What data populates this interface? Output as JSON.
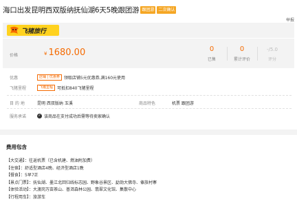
{
  "header": {
    "title": "海口出发昆明西双版纳抚仙湖6天5晚跟团游",
    "tags": [
      "跟团游",
      "二次确认"
    ],
    "report": "举报"
  },
  "brand": {
    "name": "飞猪旅行",
    "color": "#ffd21f"
  },
  "price_section": {
    "label": "价格",
    "currency": "¥",
    "price": "1680.00",
    "stats": [
      {
        "value": "0",
        "label": "已售"
      },
      {
        "value": "0",
        "label": "累计评价"
      },
      {
        "value": "-/5.0",
        "label": "评分"
      }
    ]
  },
  "promos": {
    "coupon_label": "优惠",
    "coupon_badge": "店铺 | 优惠券",
    "coupon_text": "领取店铺5元优惠券,满160元使用",
    "points_label": "飞猪里程",
    "points_badge": "飞猪里程",
    "points_text": "可抵扣840飞猪里程"
  },
  "details": {
    "destination_label": "目 的 地",
    "destination_value": "昆明  西双版纳  玉溪",
    "feature_label": "商品特色",
    "feature_value": "机票  跟团游",
    "service_label": "服务承诺",
    "service_value": "该商品在支付成功后需等待卖家确认"
  },
  "fees": {
    "title": "费用包含",
    "items": [
      "【大交通】：往返机票（已含机建、燃油附加费）",
      "【住宿】：舒适型酒店4晚、经济型酒店1晚",
      "【餐食】：5早7正",
      "【景点门票】：抚仙湖、墨江北回归线标志园、野象谷景区、勐泐大佛寺、傣族村寨",
      "【体验活动】：大渡岗万亩茶山、普洱森林公园、翡翠文化馆、集散中心",
      "【行程用车】：旅游车"
    ]
  },
  "colors": {
    "accent": "#f56a00",
    "tag": "#f5a623"
  }
}
